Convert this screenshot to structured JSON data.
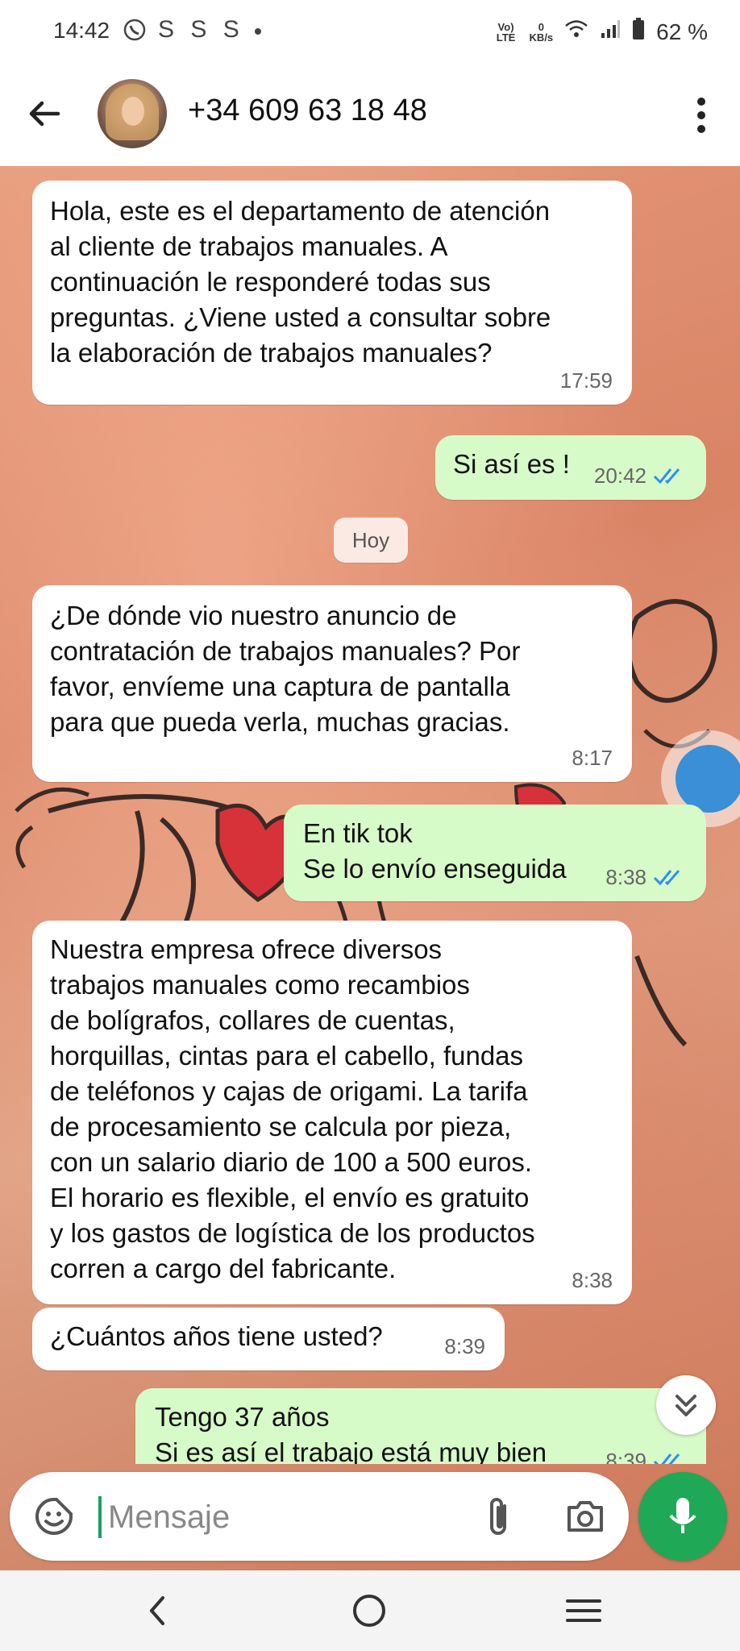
{
  "status_bar": {
    "time": "14:42",
    "notifications": "S S S",
    "network_top": "Vo) LTE",
    "speed_value": "0",
    "speed_unit": "KB/s",
    "battery": "62 %"
  },
  "header": {
    "contact": "+34 609 63 18 48"
  },
  "messages": [
    {
      "dir": "in",
      "text": "Hola, este es el departamento de atención\nal cliente de trabajos manuales. A\ncontinuación le responderé todas sus\npreguntas. ¿Viene usted a consultar sobre\nla elaboración de trabajos manuales?",
      "time": "17:59"
    },
    {
      "dir": "out",
      "text": "Si así es !",
      "time": "20:42",
      "read": true
    },
    {
      "dir": "in",
      "text": "¿De dónde vio nuestro anuncio de\ncontratación de trabajos manuales? Por\nfavor, envíeme una captura de pantalla\npara que pueda verla, muchas gracias.",
      "time": "8:17"
    },
    {
      "dir": "out",
      "text": "En tik tok\nSe lo envío enseguida",
      "time": "8:38",
      "read": true
    },
    {
      "dir": "in",
      "text": "Nuestra empresa ofrece diversos\ntrabajos manuales como recambios\nde bolígrafos, collares de cuentas,\nhorquillas, cintas para el cabello, fundas\nde teléfonos y cajas de origami. La tarifa\nde procesamiento se calcula por pieza,\ncon un salario diario de 100 a 500 euros.\nEl horario es flexible, el envío es gratuito\ny los gastos de logística de los productos\ncorren a cargo del fabricante.",
      "time": "8:38"
    },
    {
      "dir": "in",
      "text": "¿Cuántos años tiene usted?",
      "time": "8:39"
    },
    {
      "dir": "out",
      "text": "Tengo 37 años\nSi es así el trabajo está muy bien",
      "time": "8:39",
      "read": true
    }
  ],
  "day_separator": "Hoy",
  "composer": {
    "placeholder": "Mensaje"
  },
  "colors": {
    "incoming": "#ffffff",
    "outgoing": "#d7fbc8",
    "accent": "#1fa855",
    "read_ticks": "#2f8ff0"
  }
}
